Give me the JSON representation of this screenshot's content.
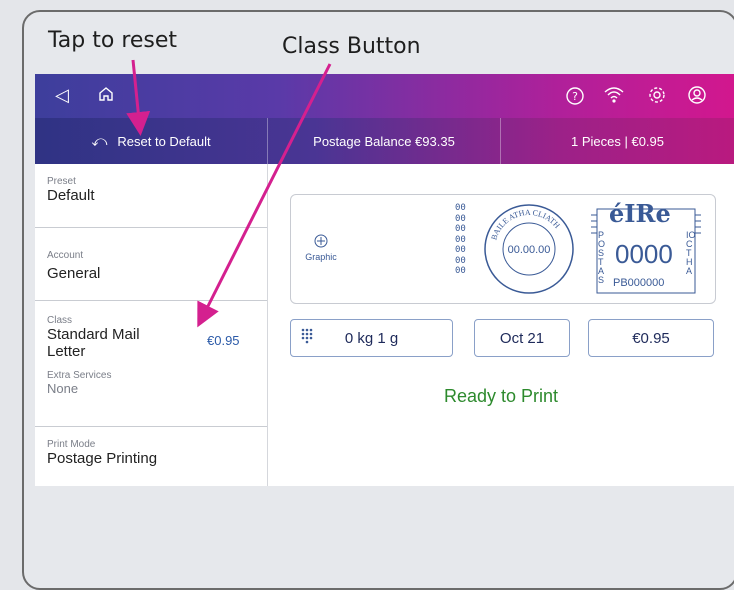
{
  "callouts": {
    "tap_to_reset": "Tap to reset",
    "class_button": "Class Button"
  },
  "subbar": {
    "reset_label": "Reset to Default",
    "postage_balance": "Postage Balance €93.35",
    "pieces": "1 Pieces | €0.95"
  },
  "sidebar": {
    "preset_label": "Preset",
    "preset_value": "Default",
    "account_label": "Account",
    "account_value": "General",
    "class_label": "Class",
    "class_value_line1": "Standard Mail",
    "class_value_line2": "Letter",
    "class_price": "€0.95",
    "extra_label": "Extra Services",
    "extra_value": "None",
    "print_mode_label": "Print Mode",
    "print_mode_value": "Postage Printing"
  },
  "indicia": {
    "graphic_label": "Graphic",
    "dots_col": "00\n00\n00\n00\n00\n00\n00",
    "postmark_top": "BAILE ATHA CLIATH",
    "postmark_date": "00.00.00",
    "eire": "éIRe",
    "amount": "0000",
    "meter_id": "PB000000",
    "left_vertical": "POSTAS",
    "right_vertical": "IOCTHA"
  },
  "controls": {
    "weight": "0 kg 1 g",
    "date": "Oct 21",
    "postage": "€0.95"
  },
  "status": "Ready to Print",
  "colors": {
    "accent_magenta": "#d2178e",
    "ready_green": "#2d8a2d",
    "arrow": "#d4208f"
  }
}
